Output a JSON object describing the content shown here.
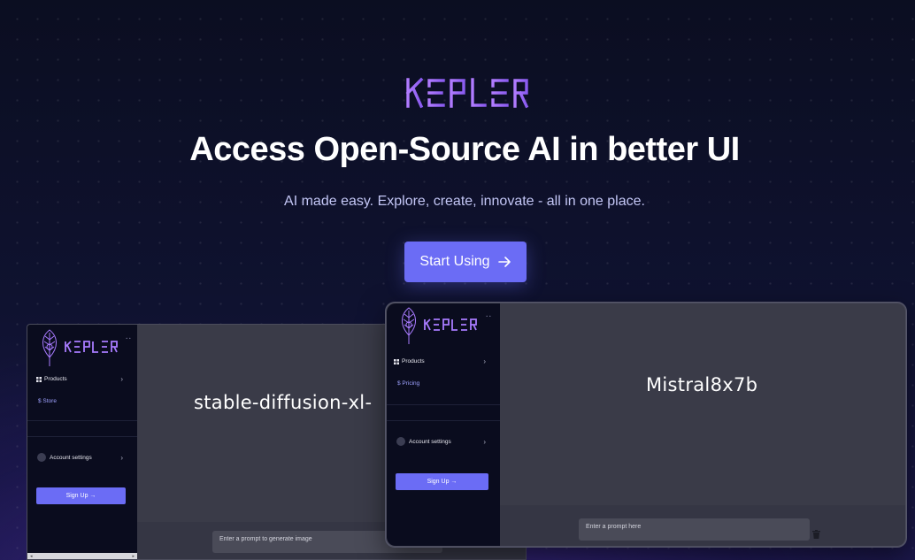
{
  "brand": {
    "name": "KEPLER",
    "color": "#9b6bff"
  },
  "hero": {
    "title": "Access Open-Source AI in better UI",
    "subtitle": "AI made easy. Explore, create, innovate - all in one place.",
    "cta_label": "Start Using"
  },
  "colors": {
    "accent": "#6b6cf5",
    "background": "#0d1029",
    "panel": "#3a3b48",
    "sidebar": "#0a0c1e"
  },
  "preview_left": {
    "logo_text": "KEPLER",
    "products_label": "Products",
    "store_label": "$ Store",
    "account_label": "Account settings",
    "signup_label": "Sign Up →",
    "model_name": "stable-diffusion-xl-",
    "prompt_placeholder": "Enter a prompt to generate image"
  },
  "preview_right": {
    "logo_text": "KEPLER",
    "products_label": "Products",
    "pricing_label": "$ Pricing",
    "account_label": "Account settings",
    "signup_label": "Sign Up →",
    "model_name": "Mistral8x7b",
    "prompt_placeholder": "Enter a prompt here"
  }
}
